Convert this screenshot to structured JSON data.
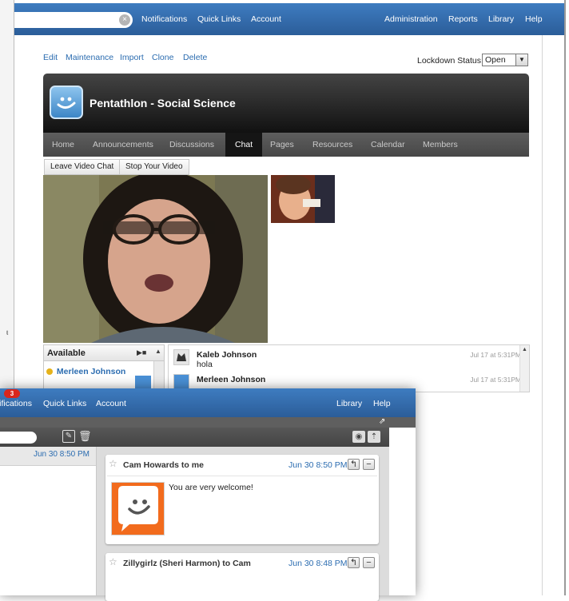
{
  "top_nav": {
    "search_placeholder": "",
    "left_links": [
      "Notifications",
      "Quick Links",
      "Account"
    ],
    "right_links": [
      "Administration",
      "Reports",
      "Library",
      "Help"
    ]
  },
  "admin_bar": {
    "links": [
      "Edit",
      "Maintenance",
      "Import",
      "Clone",
      "Delete"
    ],
    "lockdown_label": "Lockdown Status:",
    "lockdown_value": "Open"
  },
  "course": {
    "title": "Pentathlon - Social Science",
    "tabs": [
      "Home",
      "Announcements",
      "Discussions",
      "Chat",
      "Pages",
      "Resources",
      "Calendar",
      "Members"
    ],
    "active_tab": "Chat"
  },
  "video": {
    "leave_label": "Leave Video Chat",
    "stop_label": "Stop Your Video"
  },
  "available": {
    "header": "Available",
    "users": [
      "Merleen Johnson"
    ]
  },
  "chat_messages": [
    {
      "name": "Kaleb Johnson",
      "text": "hola",
      "time": "Jul 17 at 5:31PM"
    },
    {
      "name": "Merleen Johnson",
      "text": "",
      "time": "Jul 17 at 5:31PM"
    }
  ],
  "messages_window": {
    "notification_count": "3",
    "nav_links": [
      "Notifications",
      "Quick Links",
      "Account"
    ],
    "right_links": [
      "Library",
      "Help"
    ],
    "list_date": "Jun 30 8:50 PM",
    "threads": [
      {
        "header": "Cam Howards to me",
        "time": "Jun 30 8:50 PM",
        "body": "You are very welcome!"
      },
      {
        "header": "Zillygirlz (Sheri Harmon) to Cam",
        "time": "Jun 30 8:48 PM",
        "body": ""
      }
    ]
  },
  "colors": {
    "nav_blue": "#2f68a8",
    "link_blue": "#2b6cb0",
    "banner_dark": "#1b1b1b",
    "avatar_orange": "#f26b1d"
  }
}
